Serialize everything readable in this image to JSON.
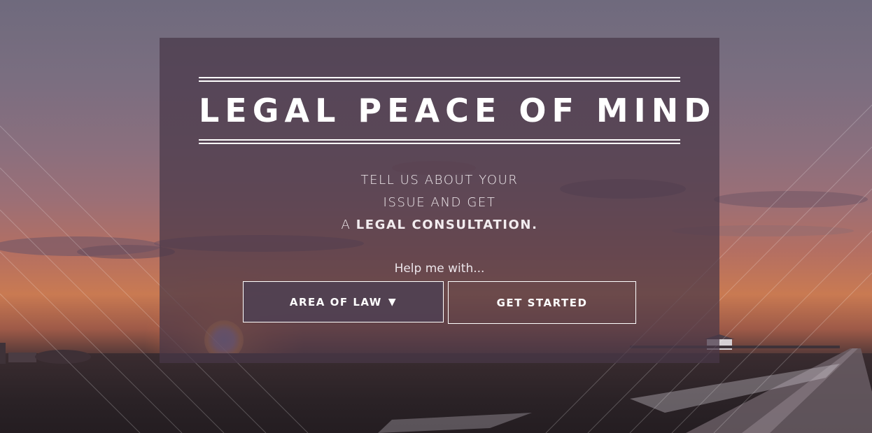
{
  "hero": {
    "headline": "LEGAL PEACE OF MIND",
    "subtext_line1": "TELL US ABOUT YOUR",
    "subtext_line2": "ISSUE AND GET",
    "subtext_line3_prefix": "A",
    "subtext_line3_strong": "LEGAL CONSULTATION.",
    "help_label": "Help me with..."
  },
  "controls": {
    "area_of_law_label": "AREA OF LAW",
    "caret_icon": "caret-down-icon",
    "get_started_label": "GET STARTED"
  },
  "colors": {
    "card_overlay": "#483848",
    "text": "#ffffff"
  }
}
